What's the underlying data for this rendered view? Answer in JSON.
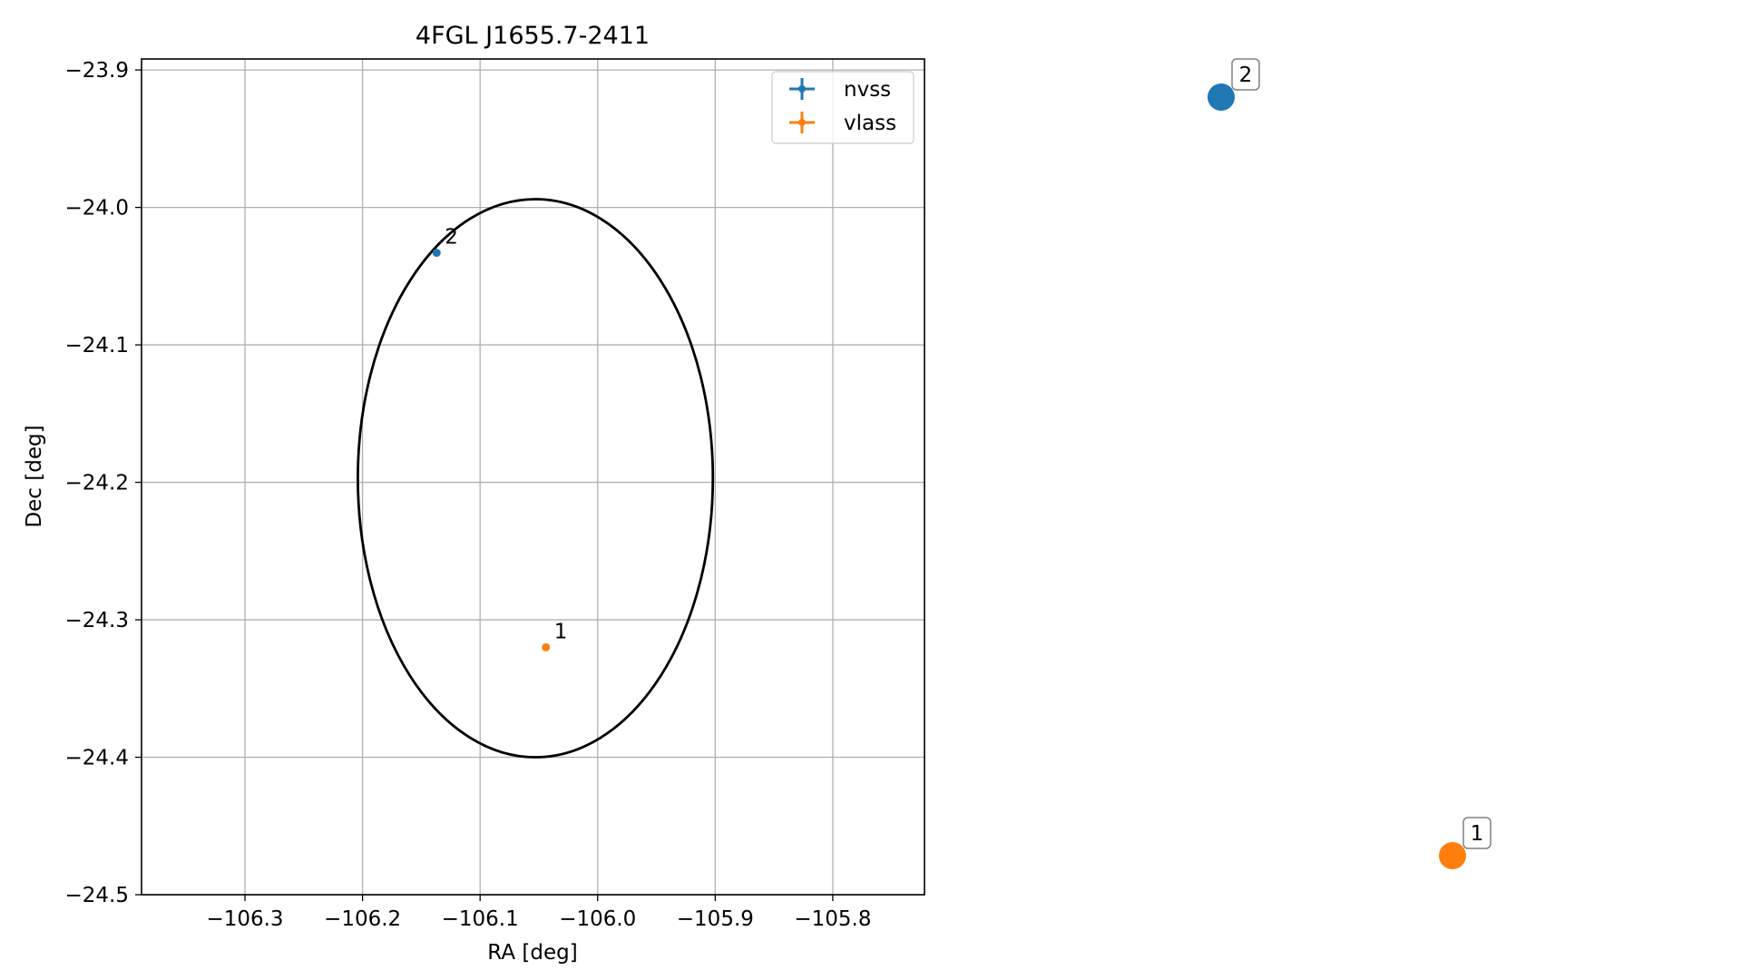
{
  "chart_data": [
    {
      "type": "scatter",
      "title": "4FGL J1655.7-2411",
      "xlabel": "RA [deg]",
      "ylabel": "Dec [deg]",
      "xlim": [
        -106.388,
        -105.722
      ],
      "ylim": [
        -24.5,
        -23.892
      ],
      "x_ticks": [
        {
          "value": -106.3,
          "label": "−106.3"
        },
        {
          "value": -106.2,
          "label": "−106.2"
        },
        {
          "value": -106.1,
          "label": "−106.1"
        },
        {
          "value": -106.0,
          "label": "−106.0"
        },
        {
          "value": -105.9,
          "label": "−105.9"
        },
        {
          "value": -105.8,
          "label": "−105.8"
        }
      ],
      "y_ticks": [
        {
          "value": -23.9,
          "label": "−23.9"
        },
        {
          "value": -24.0,
          "label": "−24.0"
        },
        {
          "value": -24.1,
          "label": "−24.1"
        },
        {
          "value": -24.2,
          "label": "−24.2"
        },
        {
          "value": -24.3,
          "label": "−24.3"
        },
        {
          "value": -24.4,
          "label": "−24.4"
        },
        {
          "value": -24.5,
          "label": "−24.5"
        }
      ],
      "grid": true,
      "legend_position": "top-right",
      "ellipse": {
        "center_x": -106.053,
        "center_y": -24.197,
        "half_width": 0.151,
        "half_height": 0.203,
        "color": "#000000"
      },
      "series": [
        {
          "name": "nvss",
          "color": "#1f77b4",
          "points": [
            {
              "x": -106.137,
              "y": -24.033,
              "label": "2"
            }
          ]
        },
        {
          "name": "vlass",
          "color": "#ff7f0e",
          "points": [
            {
              "x": -106.044,
              "y": -24.32,
              "label": "1"
            }
          ]
        }
      ]
    },
    {
      "type": "scatter",
      "axes": false,
      "points": [
        {
          "label": "2",
          "color": "#1f77b4",
          "x": 0.0,
          "y": 1.0
        },
        {
          "label": "1",
          "color": "#ff7f0e",
          "x": 1.0,
          "y": 0.0
        }
      ]
    }
  ]
}
